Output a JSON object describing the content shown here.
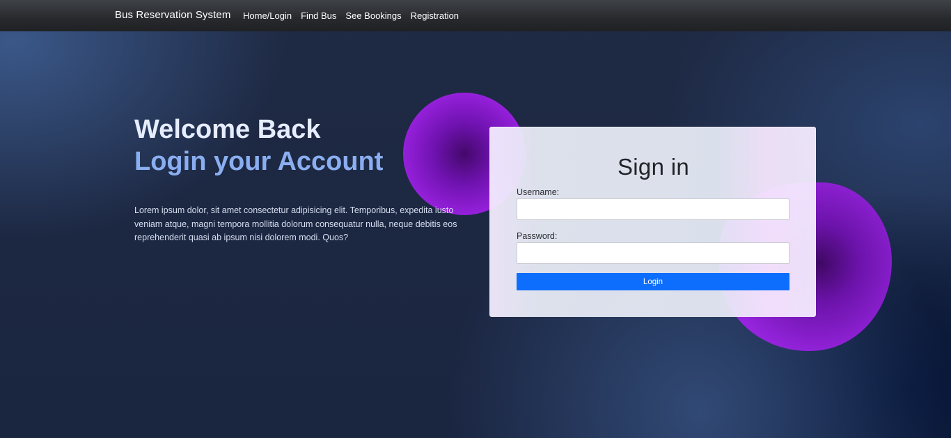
{
  "navbar": {
    "brand": "Bus Reservation System",
    "links": [
      "Home/Login",
      "Find Bus",
      "See Bookings",
      "Registration"
    ]
  },
  "hero": {
    "title": "Welcome Back",
    "subtitle": "Login your Account",
    "text": "Lorem ipsum dolor, sit amet consectetur adipisicing elit. Temporibus, expedita iusto veniam atque, magni tempora mollitia dolorum consequatur nulla, neque debitis eos reprehenderit quasi ab ipsum nisi dolorem modi. Quos?"
  },
  "signin": {
    "title": "Sign in",
    "username_label": "Username:",
    "username_value": "",
    "password_label": "Password:",
    "password_value": "",
    "login_button": "Login"
  },
  "colors": {
    "accent_button": "#0d6efd",
    "subtitle": "#8aaef0",
    "blob": "#9a22e0"
  }
}
